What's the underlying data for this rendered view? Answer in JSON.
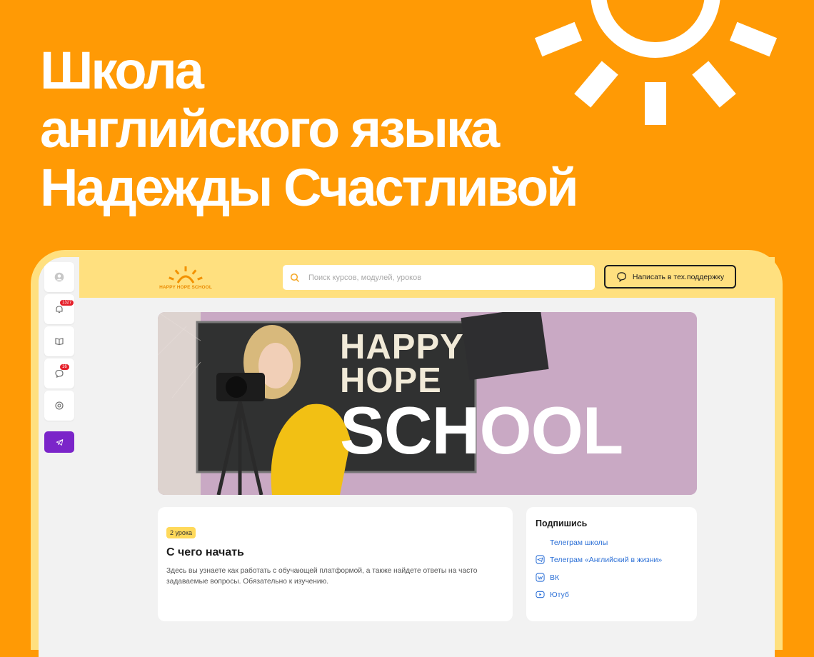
{
  "headline": {
    "line1": "Школа",
    "line2": "английского языка",
    "line3": "Надежды Счастливой"
  },
  "app": {
    "logo_text": "HAPPY HOPE SCHOOL",
    "search_placeholder": "Поиск курсов, модулей, уроков",
    "support_label": "Написать в тех.поддержку"
  },
  "sidebar": {
    "notifications_count": "1327",
    "messages_count": "16"
  },
  "banner": {
    "line1": "HAPPY",
    "line2": "HOPE",
    "line3": "SCHOOL"
  },
  "course": {
    "badge": "2 урока",
    "title": "С чего начать",
    "description": "Здесь вы узнаете как работать с обучающей платформой, а также найдете ответы на часто задаваемые вопросы. Обязательно к изучению."
  },
  "subscribe": {
    "title": "Подпишись",
    "links": [
      "Телеграм школы",
      "Телеграм «Английский в жизни»",
      "ВК",
      "Ютуб"
    ]
  },
  "colors": {
    "brand_orange": "#ff9a05",
    "app_yellow": "#ffe07f",
    "telegram_purple": "#7b25c9",
    "badge_red": "#e5202a",
    "link_blue": "#2b6fd6"
  }
}
